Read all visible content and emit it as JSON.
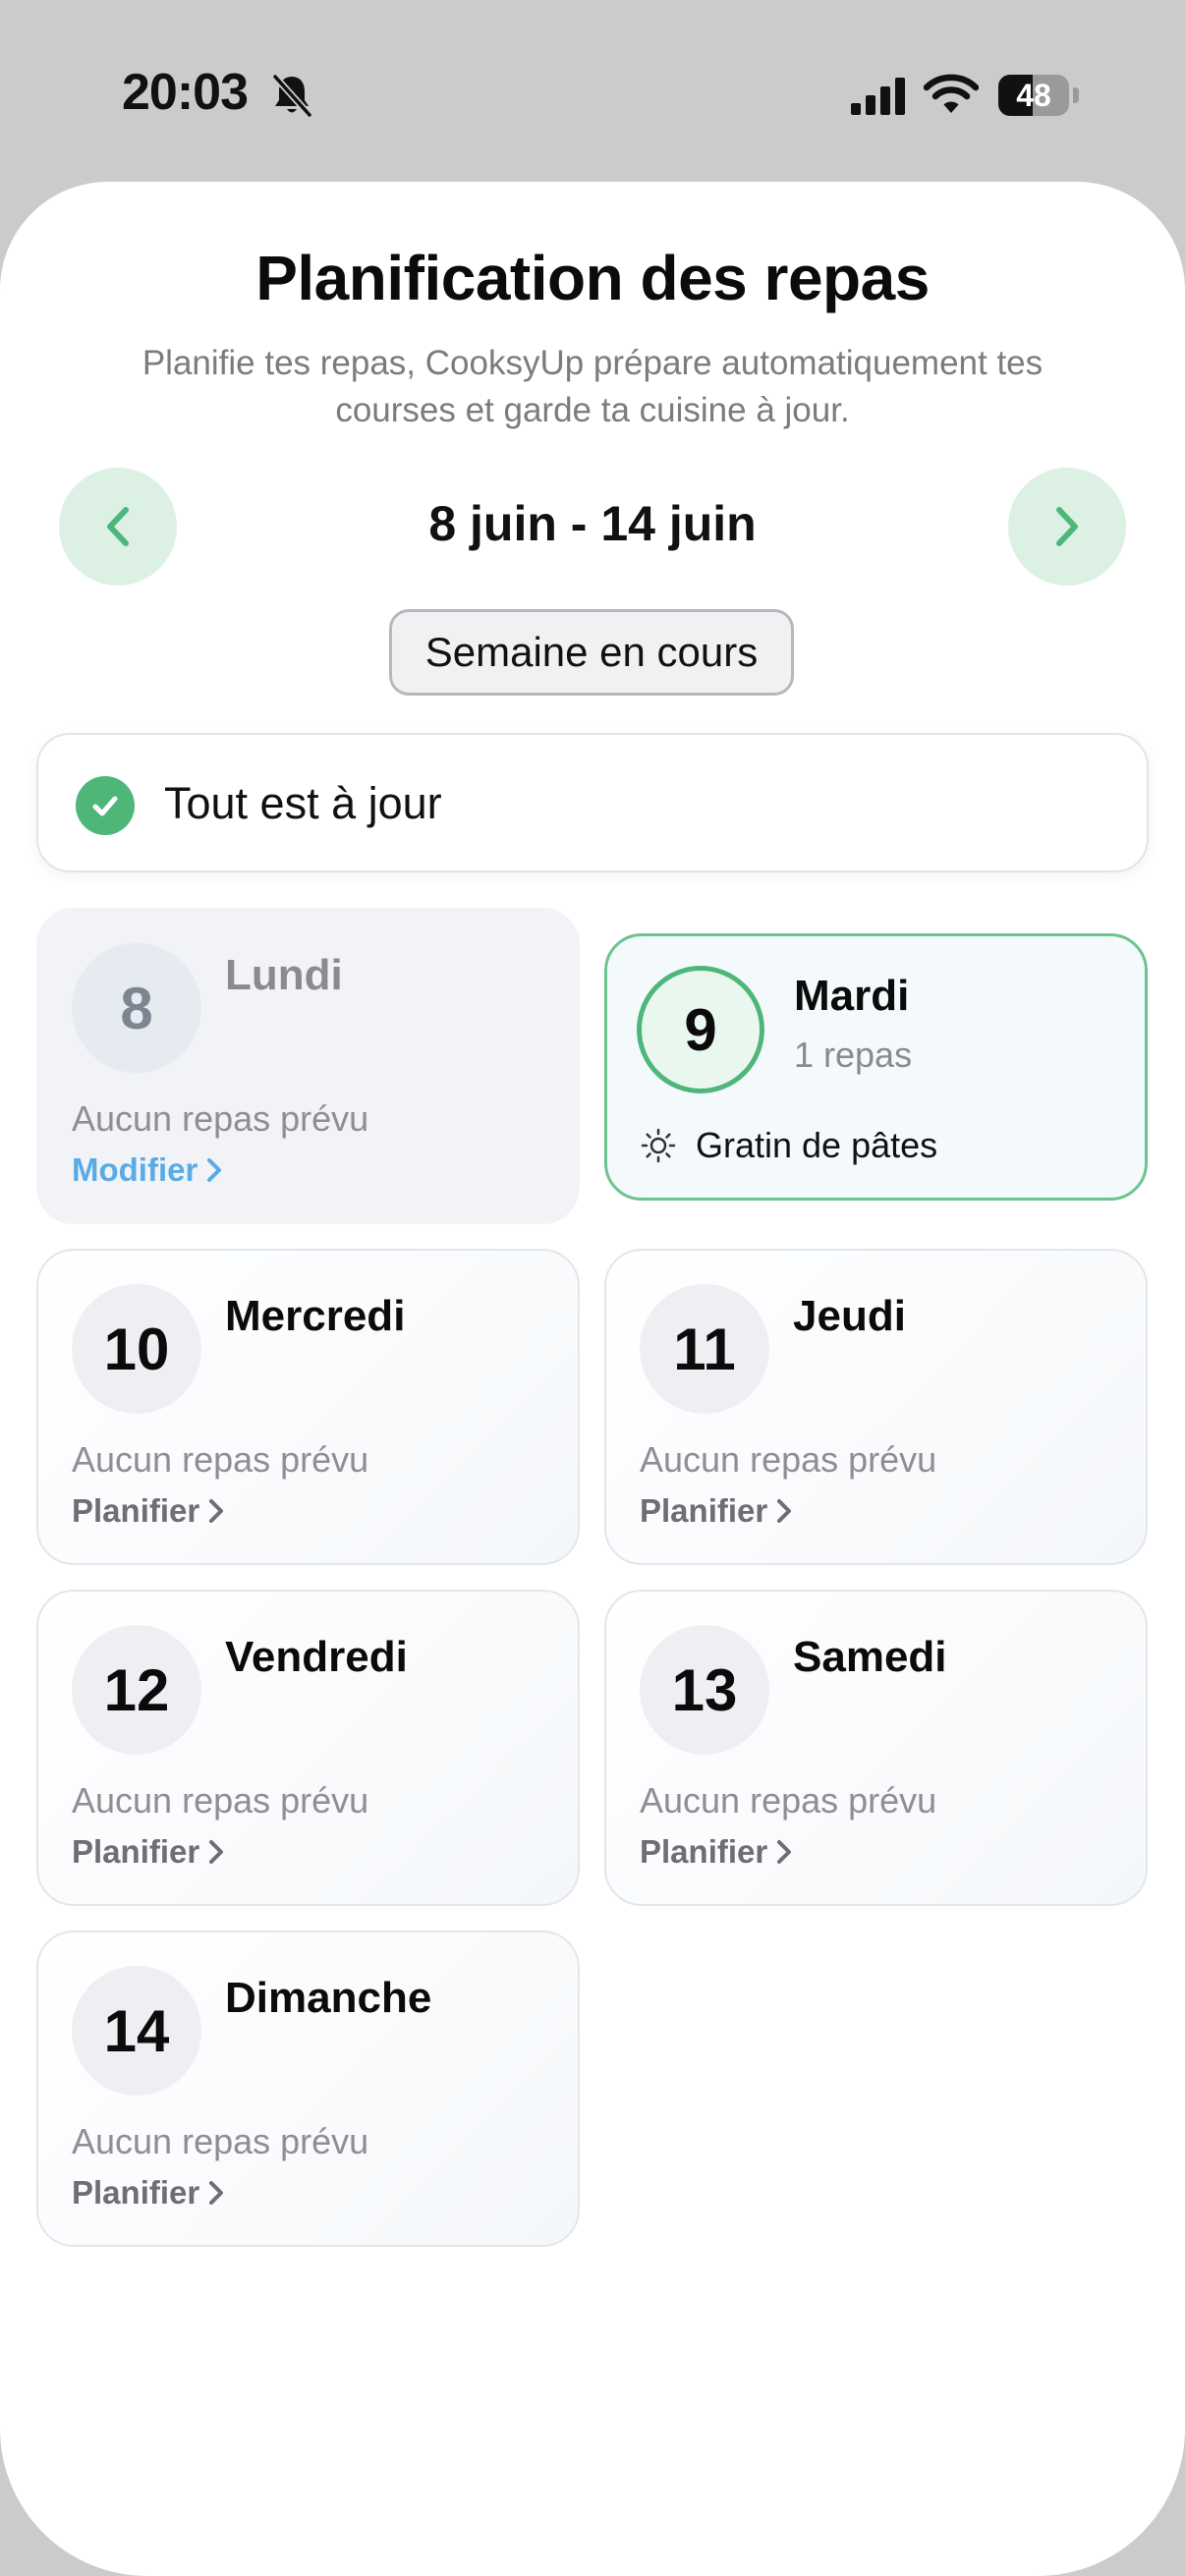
{
  "status_bar": {
    "time": "20:03",
    "battery_level": "48",
    "battery_percent": 48
  },
  "header": {
    "title": "Planification des repas",
    "subtitle": "Planifie tes repas, CooksyUp prépare automatiquement tes courses et garde ta cuisine à jour."
  },
  "week_nav": {
    "range": "8 juin - 14 juin",
    "current_week_label": "Semaine en cours"
  },
  "sync_status": {
    "label": "Tout est à jour"
  },
  "days": [
    {
      "number": "8",
      "name": "Lundi",
      "state": "past",
      "empty_text": "Aucun repas prévu",
      "action_label": "Modifier"
    },
    {
      "number": "9",
      "name": "Mardi",
      "state": "today",
      "meals_count": "1 repas",
      "meal_icon": "sun-icon",
      "meal_name": "Gratin de pâtes"
    },
    {
      "number": "10",
      "name": "Mercredi",
      "state": "upcoming",
      "empty_text": "Aucun repas prévu",
      "action_label": "Planifier"
    },
    {
      "number": "11",
      "name": "Jeudi",
      "state": "upcoming",
      "empty_text": "Aucun repas prévu",
      "action_label": "Planifier"
    },
    {
      "number": "12",
      "name": "Vendredi",
      "state": "upcoming",
      "empty_text": "Aucun repas prévu",
      "action_label": "Planifier"
    },
    {
      "number": "13",
      "name": "Samedi",
      "state": "upcoming",
      "empty_text": "Aucun repas prévu",
      "action_label": "Planifier"
    },
    {
      "number": "14",
      "name": "Dimanche",
      "state": "upcoming",
      "empty_text": "Aucun repas prévu",
      "action_label": "Planifier"
    }
  ],
  "colors": {
    "accent_green": "#4fb67a",
    "nav_green_bg": "#dcf1e4",
    "link_blue": "#5aabe5"
  }
}
